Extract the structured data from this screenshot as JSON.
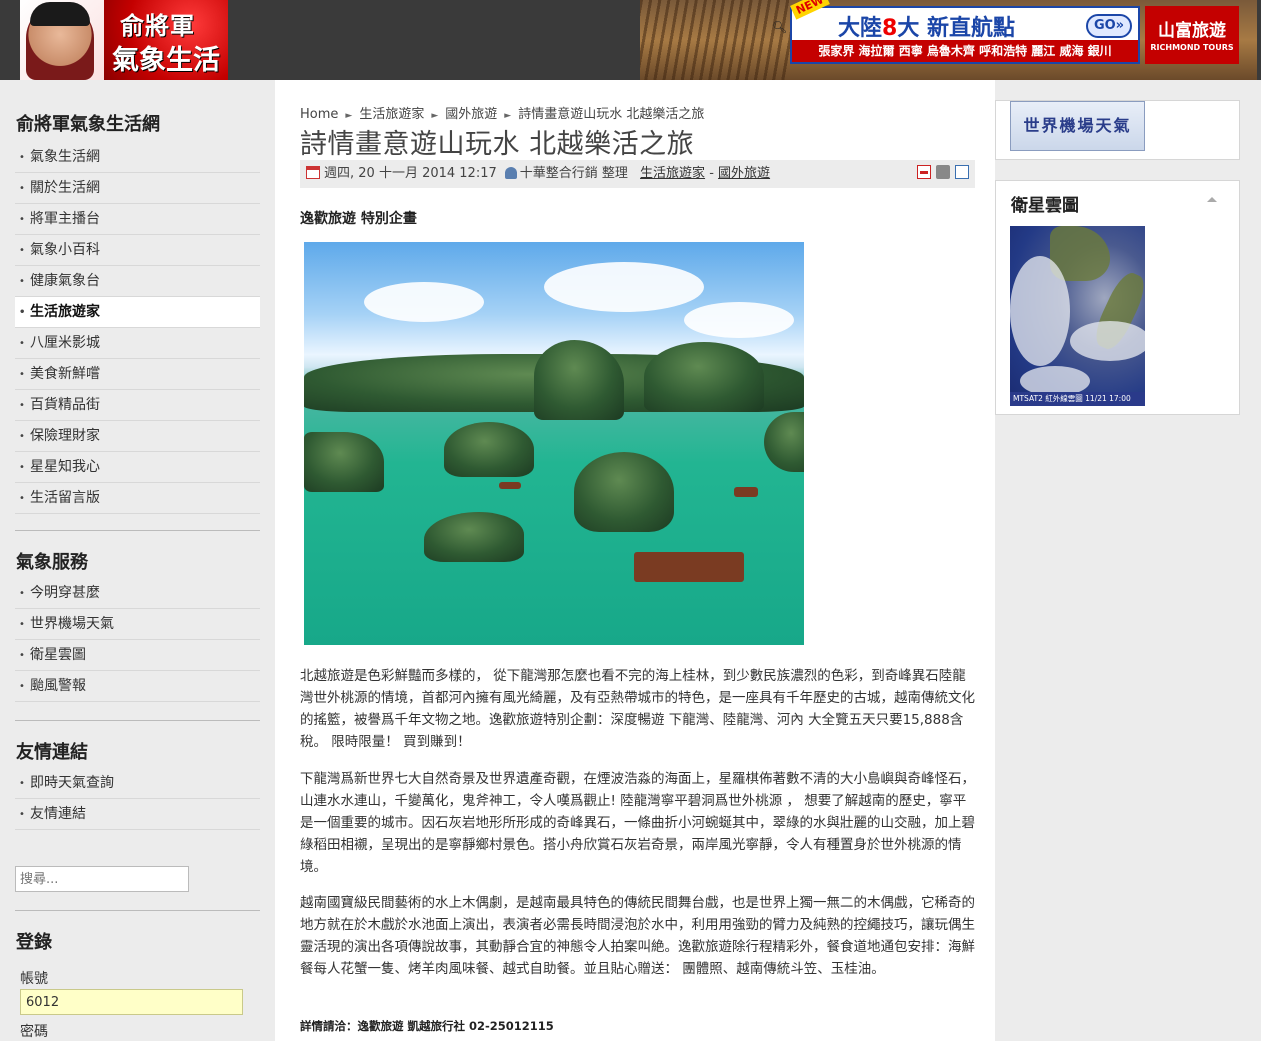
{
  "header": {
    "logo_line1": "俞將軍",
    "logo_line2": "氣象生活網",
    "banner": {
      "new_tag": "NEW",
      "headline_a": "大陸",
      "headline_num": "8",
      "headline_b": "大  新直航點",
      "go_label": "GO»",
      "cities": "張家界 海拉爾 西寧 烏魯木齊 呼和浩特 麗江 威海 銀川",
      "brand_name": "山富旅遊",
      "brand_en": "RICHMOND TOURS"
    }
  },
  "sidebar": {
    "section1_title": "俞將軍氣象生活網",
    "section1_items": [
      "氣象生活網",
      "關於生活網",
      "將軍主播台",
      "氣象小百科",
      "健康氣象台",
      "生活旅遊家",
      "八厘米影城",
      "美食新鮮嚐",
      "百貨精品街",
      "保險理財家",
      "星星知我心",
      "生活留言版"
    ],
    "section2_title": "氣象服務",
    "section2_items": [
      "今明穿甚麼",
      "世界機場天氣",
      "衛星雲圖",
      "颱風警報"
    ],
    "section3_title": "友情連結",
    "section3_items": [
      "即時天氣查詢",
      "友情連結"
    ],
    "search_placeholder": "搜尋...",
    "login_title": "登錄",
    "username_label": "帳號",
    "username_value": "6012",
    "password_label": "密碼"
  },
  "main": {
    "breadcrumb": [
      "Home",
      "生活旅遊家",
      "國外旅遊",
      "詩情畫意遊山玩水 北越樂活之旅"
    ],
    "title": "詩情畫意遊山玩水 北越樂活之旅",
    "meta_date": "週四, 20 十一月 2014 12:17",
    "meta_author": "十華整合行銷 整理",
    "meta_cat1": "生活旅遊家",
    "meta_sep": "-",
    "meta_cat2": "國外旅遊",
    "subhead": "逸歡旅遊  特別企畫",
    "paragraphs": [
      "北越旅遊是色彩鮮豔而多樣的，  從下龍灣那怎麼也看不完的海上桂林，到少數民族濃烈的色彩，到奇峰異石陸龍灣世外桃源的情境，首都河內擁有風光綺麗，及有亞熱帶城市的特色，是一座具有千年歷史的古城，越南傳統文化的搖籃，被譽爲千年文物之地。逸歡旅遊特別企劃：深度暢遊 下龍灣、陸龍灣、河內 大全覽五天只要15,888含稅。 限時限量！ 買到賺到！",
      "下龍灣爲新世界七大自然奇景及世界遺產奇觀，在煙波浩淼的海面上，星羅棋佈著數不清的大小島嶼與奇峰怪石，山連水水連山，千變萬化，鬼斧神工，令人嘆爲觀止! 陸龍灣寧平碧洞爲世外桃源 ，  想要了解越南的歷史，寧平是一個重要的城市。因石灰岩地形所形成的奇峰異石，一條曲折小河蜿蜒其中，翠綠的水與壯麗的山交融，加上碧綠稻田相襯，呈現出的是寧靜鄉村景色。搭小舟欣賞石灰岩奇景，兩岸風光寧靜，令人有種置身於世外桃源的情境。",
      "越南國寶級民間藝術的水上木偶劇，是越南最具特色的傳統民間舞台戲，也是世界上獨一無二的木偶戲，它稀奇的地方就在於木戲於水池面上演出，表演者必需長時間浸泡於水中，利用用強勁的臂力及純熟的控繩技巧，讓玩偶生靈活現的演出各項傳說故事，其動靜合宜的神態令人拍案叫絶。逸歡旅遊除行程精彩外，餐食道地通包安排：海鮮餐每人花蟹一隻、烤羊肉風味餐、越式自助餐。並且貼心贈送：  團體照、越南傳統斗笠、玉桂油。"
    ],
    "contact": "詳情請洽：逸歡旅遊 凱越旅行社 02-25012115"
  },
  "right": {
    "airport_banner": "世界機場天氣",
    "satellite_title": "衛星雲圖",
    "satellite_caption": "MTSAT2 紅外線雲圖    11/21  17:00"
  }
}
